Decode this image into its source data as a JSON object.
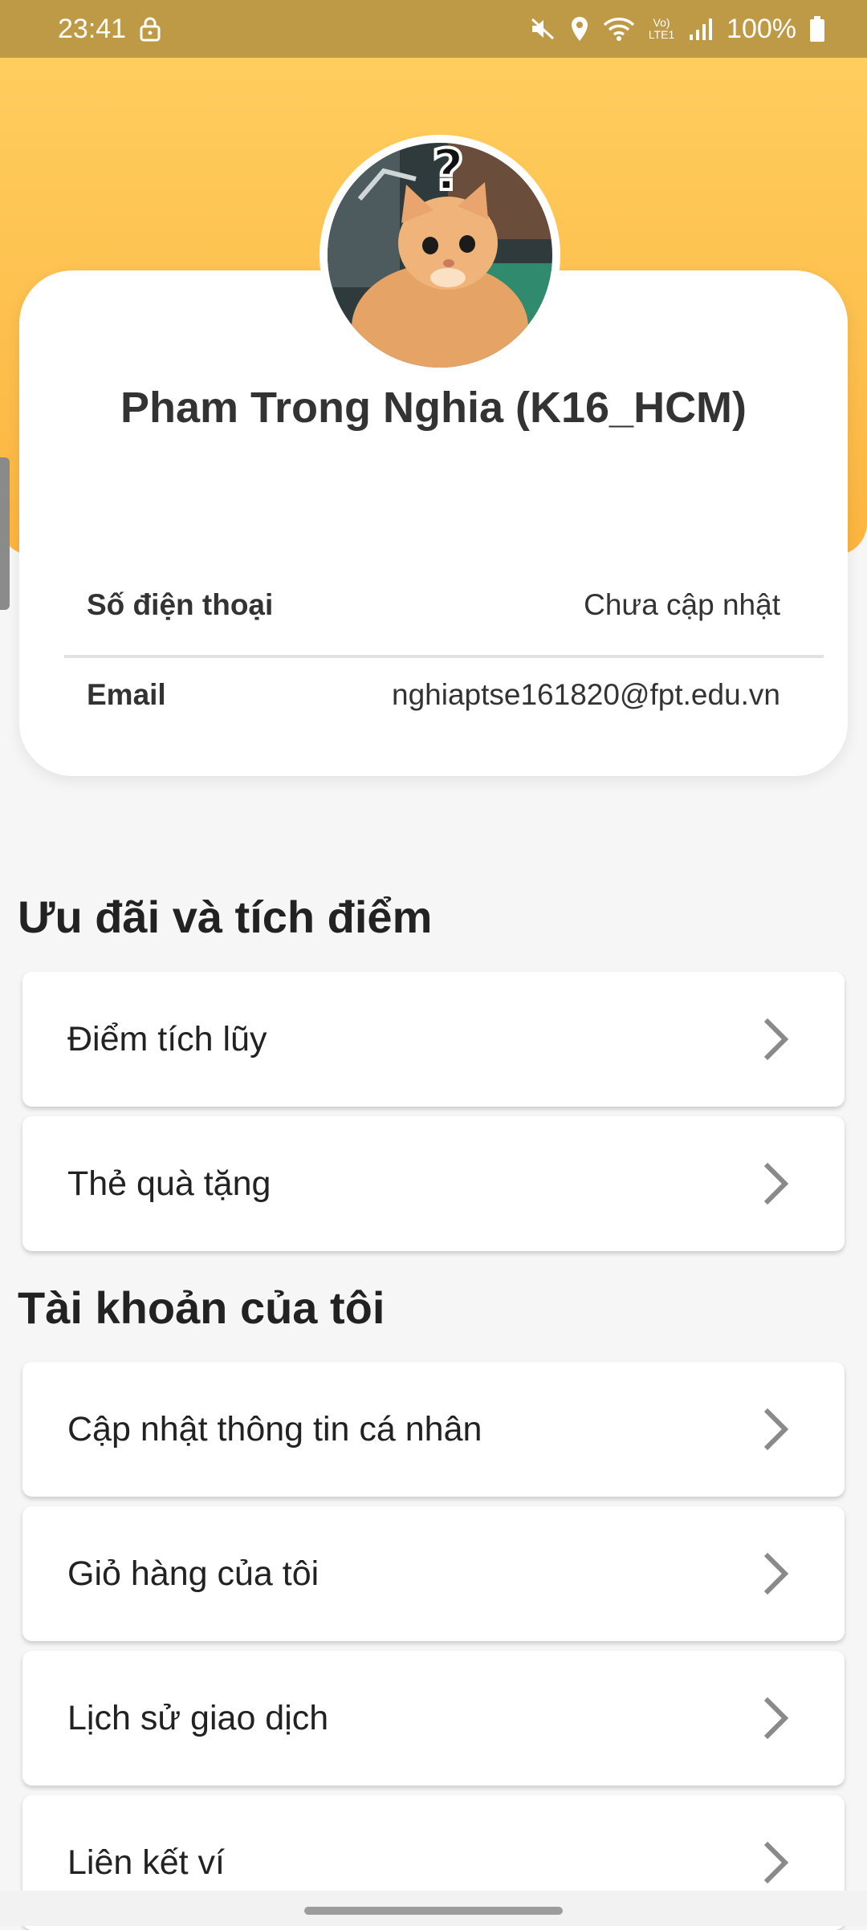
{
  "status_bar": {
    "time": "23:41",
    "battery": "100%",
    "network": "Vo) LTE1"
  },
  "profile": {
    "name": "Pham Trong Nghia (K16_HCM)",
    "phone_label": "Số điện thoại",
    "phone_value": "Chưa cập nhật",
    "email_label": "Email",
    "email_value": "nghiaptse161820@fpt.edu.vn"
  },
  "sections": {
    "rewards_title": "Ưu đãi và tích điểm",
    "account_title": "Tài khoản của tôi"
  },
  "menu": {
    "points": "Điểm tích lũy",
    "gift_card": "Thẻ quà tặng",
    "update_info": "Cập nhật thông tin cá nhân",
    "cart": "Giỏ hàng của tôi",
    "history": "Lịch sử giao dịch",
    "wallet": "Liên kết ví"
  },
  "colors": {
    "status_bar": "#be9a47",
    "hero_top": "#ffcd5e",
    "hero_bottom": "#fcb53f",
    "card_bg": "#ffffff"
  },
  "icons": [
    "lock-icon",
    "mute-icon",
    "location-icon",
    "wifi-icon",
    "signal-icon",
    "battery-icon",
    "chevron-right-icon"
  ]
}
